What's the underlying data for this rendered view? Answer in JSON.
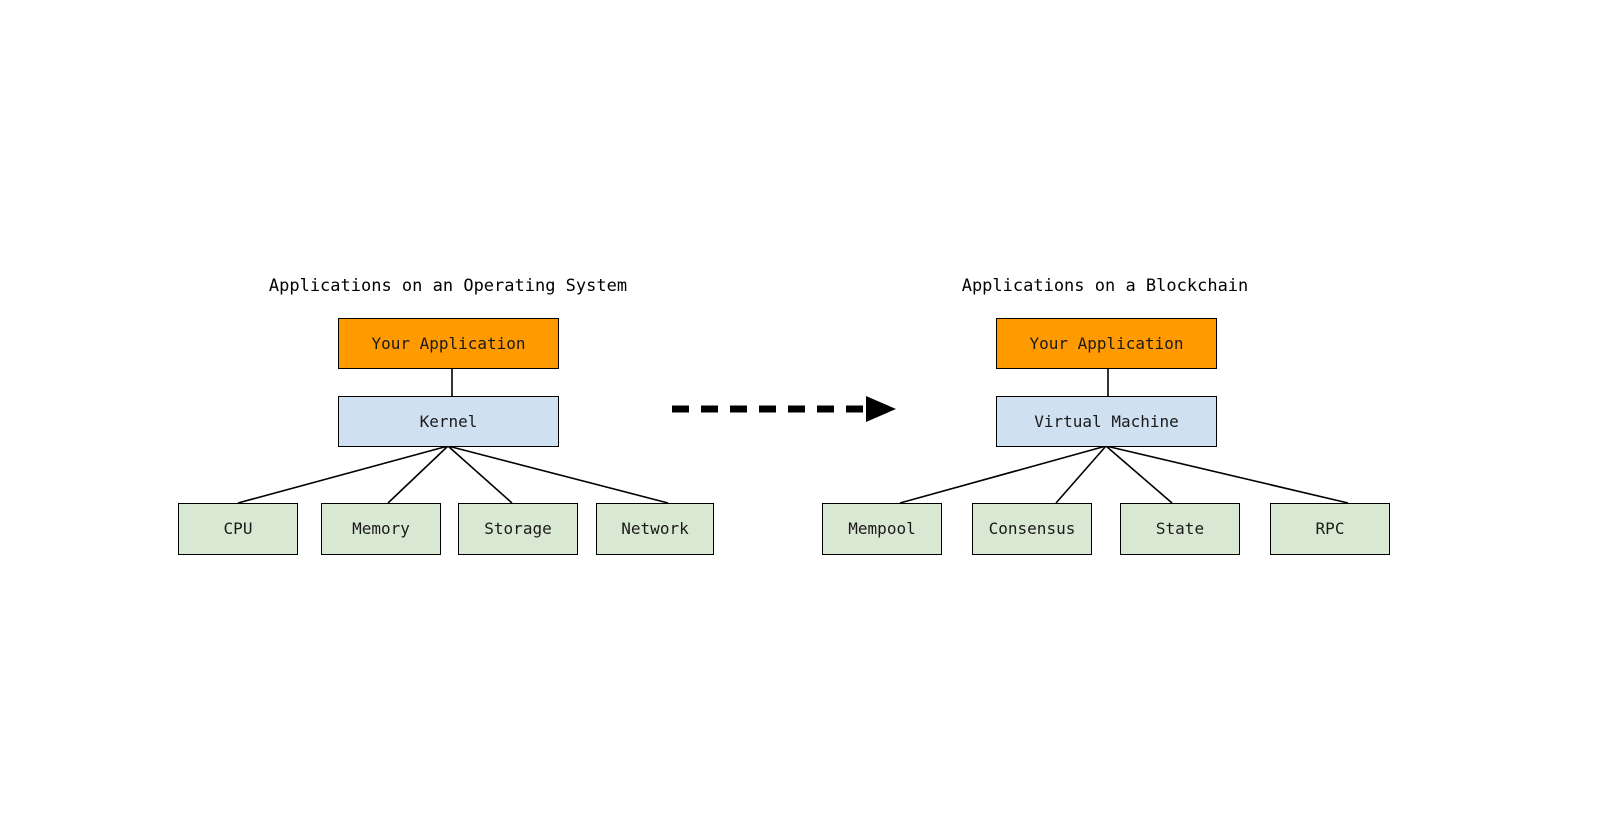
{
  "diagram": {
    "type": "comparison-architecture-diagram",
    "background_color": "#ffffff",
    "colors": {
      "application": "#FF9A00",
      "platform": "#CFE0F0",
      "resource": "#D9E8D2",
      "stroke": "#000000",
      "text": "#1a1a1a"
    },
    "panels": [
      {
        "id": "operating-system",
        "title": "Applications on an Operating System",
        "application": {
          "label": "Your Application",
          "color": "#FF9A00"
        },
        "platform": {
          "label": "Kernel",
          "color": "#CFE0F0"
        },
        "resources": [
          {
            "label": "CPU",
            "color": "#D9E8D2"
          },
          {
            "label": "Memory",
            "color": "#D9E8D2"
          },
          {
            "label": "Storage",
            "color": "#D9E8D2"
          },
          {
            "label": "Network",
            "color": "#D9E8D2"
          }
        ]
      },
      {
        "id": "blockchain",
        "title": "Applications on a Blockchain",
        "application": {
          "label": "Your Application",
          "color": "#FF9A00"
        },
        "platform": {
          "label": "Virtual Machine",
          "color": "#CFE0F0"
        },
        "resources": [
          {
            "label": "Mempool",
            "color": "#D9E8D2"
          },
          {
            "label": "Consensus",
            "color": "#D9E8D2"
          },
          {
            "label": "State",
            "color": "#D9E8D2"
          },
          {
            "label": "RPC",
            "color": "#D9E8D2"
          }
        ]
      }
    ],
    "transition_arrow": {
      "name": "dashed-right-arrow-icon",
      "style": "dashed",
      "direction": "right",
      "label": ""
    }
  }
}
